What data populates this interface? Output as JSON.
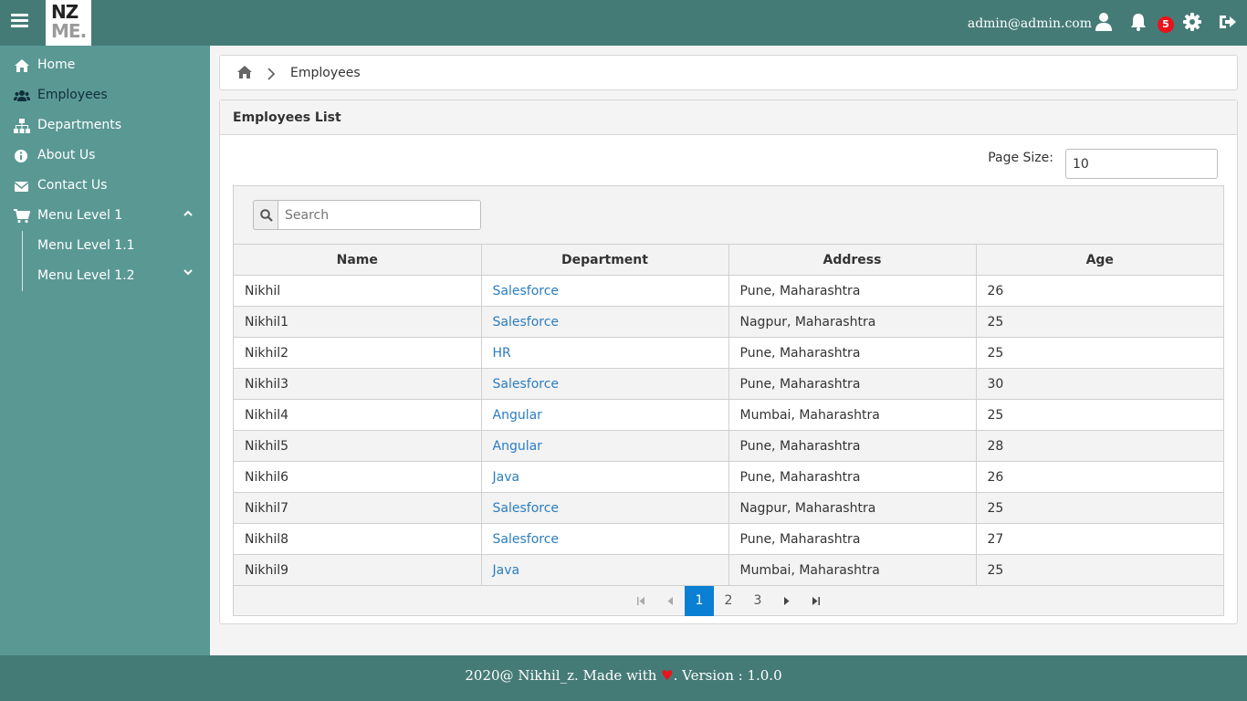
{
  "topbar": {
    "logo_line1": "NZ",
    "logo_line2": "ME.",
    "user_email": "admin@admin.com",
    "notification_count": "5",
    "icons": [
      "menu-icon",
      "user-icon",
      "bell-icon",
      "gear-icon",
      "logout-icon"
    ]
  },
  "sidebar": {
    "items": [
      {
        "label": "Home",
        "icon": "home-icon"
      },
      {
        "label": "Employees",
        "icon": "users-icon"
      },
      {
        "label": "Departments",
        "icon": "sitemap-icon"
      },
      {
        "label": "About Us",
        "icon": "info-icon"
      },
      {
        "label": "Contact Us",
        "icon": "envelope-icon"
      },
      {
        "label": "Menu Level 1",
        "icon": "cart-icon"
      },
      {
        "label": "Menu Level 1.1"
      },
      {
        "label": "Menu Level 1.2"
      }
    ]
  },
  "breadcrumb": {
    "current": "Employees"
  },
  "panel": {
    "title": "Employees List",
    "page_size_label": "Page Size:",
    "page_size_value": "10",
    "search_placeholder": "Search"
  },
  "table": {
    "columns": [
      "Name",
      "Department",
      "Address",
      "Age"
    ],
    "rows": [
      [
        "Nikhil",
        "Salesforce",
        "Pune, Maharashtra",
        "26"
      ],
      [
        "Nikhil1",
        "Salesforce",
        "Nagpur, Maharashtra",
        "25"
      ],
      [
        "Nikhil2",
        "HR",
        "Pune, Maharashtra",
        "25"
      ],
      [
        "Nikhil3",
        "Salesforce",
        "Pune, Maharashtra",
        "30"
      ],
      [
        "Nikhil4",
        "Angular",
        "Mumbai, Maharashtra",
        "25"
      ],
      [
        "Nikhil5",
        "Angular",
        "Pune, Maharashtra",
        "28"
      ],
      [
        "Nikhil6",
        "Java",
        "Pune, Maharashtra",
        "26"
      ],
      [
        "Nikhil7",
        "Salesforce",
        "Nagpur, Maharashtra",
        "25"
      ],
      [
        "Nikhil8",
        "Salesforce",
        "Pune, Maharashtra",
        "27"
      ],
      [
        "Nikhil9",
        "Java",
        "Mumbai, Maharashtra",
        "25"
      ]
    ]
  },
  "pagination": {
    "pages": [
      "1",
      "2",
      "3"
    ],
    "current": "1"
  },
  "footer": {
    "prefix": "2020@ Nikhil_z. Made with ",
    "heart": "♥",
    "suffix": ". Version : 1.0.0"
  },
  "colors": {
    "header_bg": "#457b77",
    "sidebar_bg": "#5a9894",
    "link": "#2a7dc0",
    "active_page": "#0a7fd3",
    "badge": "#e8141b"
  }
}
